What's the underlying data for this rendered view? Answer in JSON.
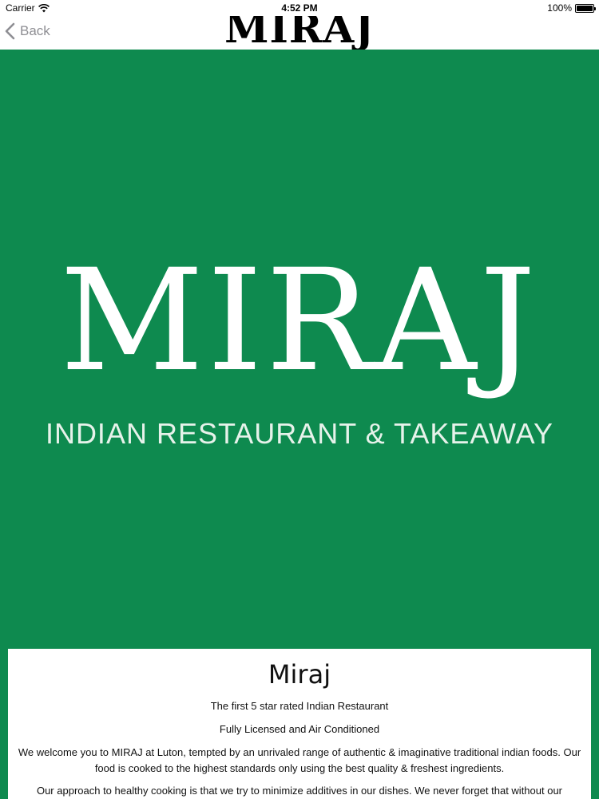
{
  "status_bar": {
    "carrier": "Carrier",
    "time": "4:52 PM",
    "battery": "100%",
    "icons": [
      "wifi-icon",
      "battery-icon"
    ]
  },
  "nav": {
    "back_label": "Back",
    "title": "MIRAJ",
    "back_icon": "chevron-left-icon"
  },
  "hero": {
    "logo": "MIRAJ",
    "tagline": "INDIAN RESTAURANT & TAKEAWAY",
    "background_color": "#0e8a4f"
  },
  "info": {
    "title": "Miraj",
    "line1": "The first 5 star rated Indian Restaurant",
    "line2": "Fully Licensed and Air Conditioned",
    "para1": "We welcome you to MIRAJ at Luton, tempted by an unrivaled range of authentic & imaginative traditional indian foods. Our food is cooked to the highest standards only using the best quality & freshest ingredients.",
    "para2": "Our approach to healthy cooking is that we try to minimize additives in our dishes. We never forget that without our"
  }
}
